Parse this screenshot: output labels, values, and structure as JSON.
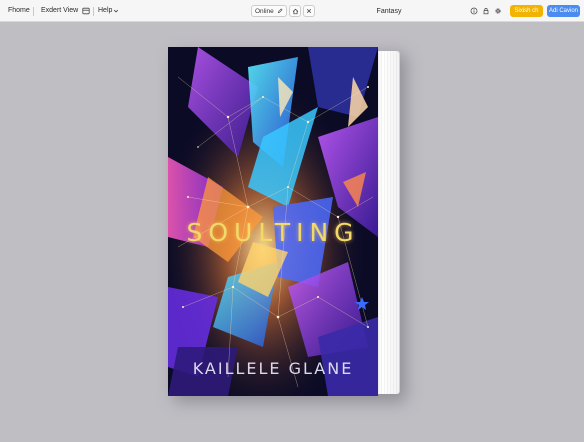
{
  "toolbar": {
    "home_label": "Fhome",
    "view_label": "Exdert View",
    "help_label": "Help",
    "mode_label": "Online",
    "window_title": "Fantasy",
    "primary_button_label": "Sixish ch",
    "secondary_button_label": "Adi Cavion"
  },
  "icons": {
    "layout": "layout-icon",
    "help_dropdown": "chevron-down-icon",
    "edit": "pencil-icon",
    "home": "home-icon",
    "close": "close-icon",
    "info": "info-icon",
    "lock": "lock-icon",
    "settings": "gear-icon"
  },
  "book": {
    "title": "SOULTING",
    "author": "KAILLELE GLANE"
  },
  "colors": {
    "canvas_background": "#bfbec3",
    "toolbar_background": "#f6f6f7",
    "primary_button": "#f2b400",
    "secondary_button": "#4a8cf0",
    "title_text": "#f1d96a",
    "author_text": "#dcd9ee"
  }
}
